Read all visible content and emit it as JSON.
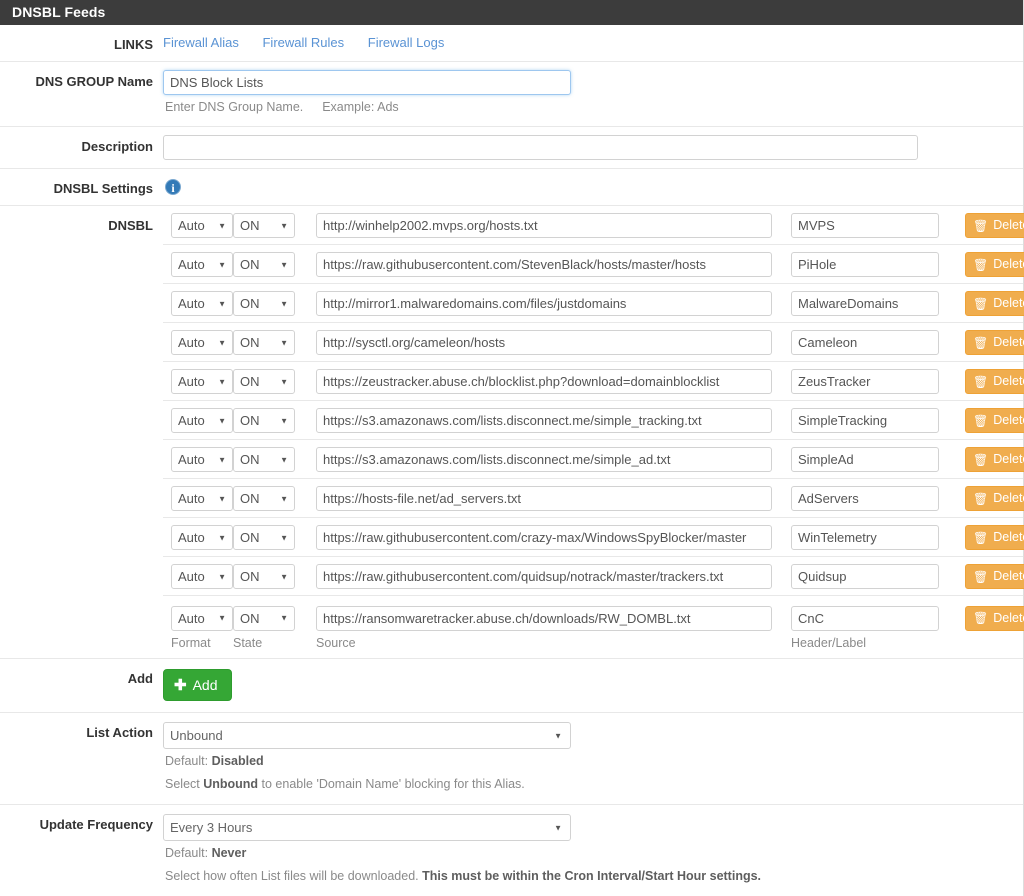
{
  "panel": {
    "title": "DNSBL Feeds"
  },
  "links": {
    "label": "LINKS",
    "items": [
      {
        "label": "Firewall Alias"
      },
      {
        "label": "Firewall Rules"
      },
      {
        "label": "Firewall Logs"
      }
    ]
  },
  "group_name": {
    "label": "DNS GROUP Name",
    "value": "DNS Block Lists",
    "placeholder": "",
    "help_1": "Enter DNS Group Name.",
    "help_2": "Example: Ads"
  },
  "description": {
    "label": "Description",
    "value": "",
    "placeholder": ""
  },
  "dnsbl_settings": {
    "label": "DNSBL Settings",
    "info_icon": "info-icon",
    "info_glyph": "i"
  },
  "dnsbl": {
    "label": "DNSBL",
    "columns": {
      "format": "Format",
      "state": "State",
      "source": "Source",
      "header": "Header/Label"
    },
    "format_options": [
      "Auto"
    ],
    "state_options": [
      "ON"
    ],
    "delete_label": "Delete",
    "delete_icon": "trash-icon",
    "rows": [
      {
        "format": "Auto",
        "state": "ON",
        "source": "http://winhelp2002.mvps.org/hosts.txt",
        "header": "MVPS"
      },
      {
        "format": "Auto",
        "state": "ON",
        "source": "https://raw.githubusercontent.com/StevenBlack/hosts/master/hosts",
        "header": "PiHole"
      },
      {
        "format": "Auto",
        "state": "ON",
        "source": "http://mirror1.malwaredomains.com/files/justdomains",
        "header": "MalwareDomains"
      },
      {
        "format": "Auto",
        "state": "ON",
        "source": "http://sysctl.org/cameleon/hosts",
        "header": "Cameleon"
      },
      {
        "format": "Auto",
        "state": "ON",
        "source": "https://zeustracker.abuse.ch/blocklist.php?download=domainblocklist",
        "header": "ZeusTracker"
      },
      {
        "format": "Auto",
        "state": "ON",
        "source": "https://s3.amazonaws.com/lists.disconnect.me/simple_tracking.txt",
        "header": "SimpleTracking"
      },
      {
        "format": "Auto",
        "state": "ON",
        "source": "https://s3.amazonaws.com/lists.disconnect.me/simple_ad.txt",
        "header": "SimpleAd"
      },
      {
        "format": "Auto",
        "state": "ON",
        "source": "https://hosts-file.net/ad_servers.txt",
        "header": "AdServers"
      },
      {
        "format": "Auto",
        "state": "ON",
        "source": "https://raw.githubusercontent.com/crazy-max/WindowsSpyBlocker/master",
        "header": "WinTelemetry"
      },
      {
        "format": "Auto",
        "state": "ON",
        "source": "https://raw.githubusercontent.com/quidsup/notrack/master/trackers.txt",
        "header": "Quidsup"
      },
      {
        "format": "Auto",
        "state": "ON",
        "source": "https://ransomwaretracker.abuse.ch/downloads/RW_DOMBL.txt",
        "header": "CnC"
      }
    ]
  },
  "add": {
    "label": "Add",
    "button_label": "Add",
    "plus_icon": "plus-icon"
  },
  "list_action": {
    "label": "List Action",
    "value": "Unbound",
    "options": [
      "Unbound"
    ],
    "help_default_prefix": "Default: ",
    "help_default_value": "Disabled",
    "help_line2_a": "Select ",
    "help_line2_b": "Unbound",
    "help_line2_c": " to enable 'Domain Name' blocking for this Alias."
  },
  "update_frequency": {
    "label": "Update Frequency",
    "value": "Every 3 Hours",
    "options": [
      "Every 3 Hours"
    ],
    "help_default_prefix": "Default: ",
    "help_default_value": "Never",
    "help_line2_a": "Select how often List files will be downloaded. ",
    "help_line2_b": "This must be within the Cron Interval/Start Hour settings."
  },
  "colors": {
    "header_bg": "#3c3c3c",
    "link": "#5a93d4",
    "delete_btn": "#f0ad4e",
    "add_btn": "#35a735",
    "info": "#337ab7"
  }
}
